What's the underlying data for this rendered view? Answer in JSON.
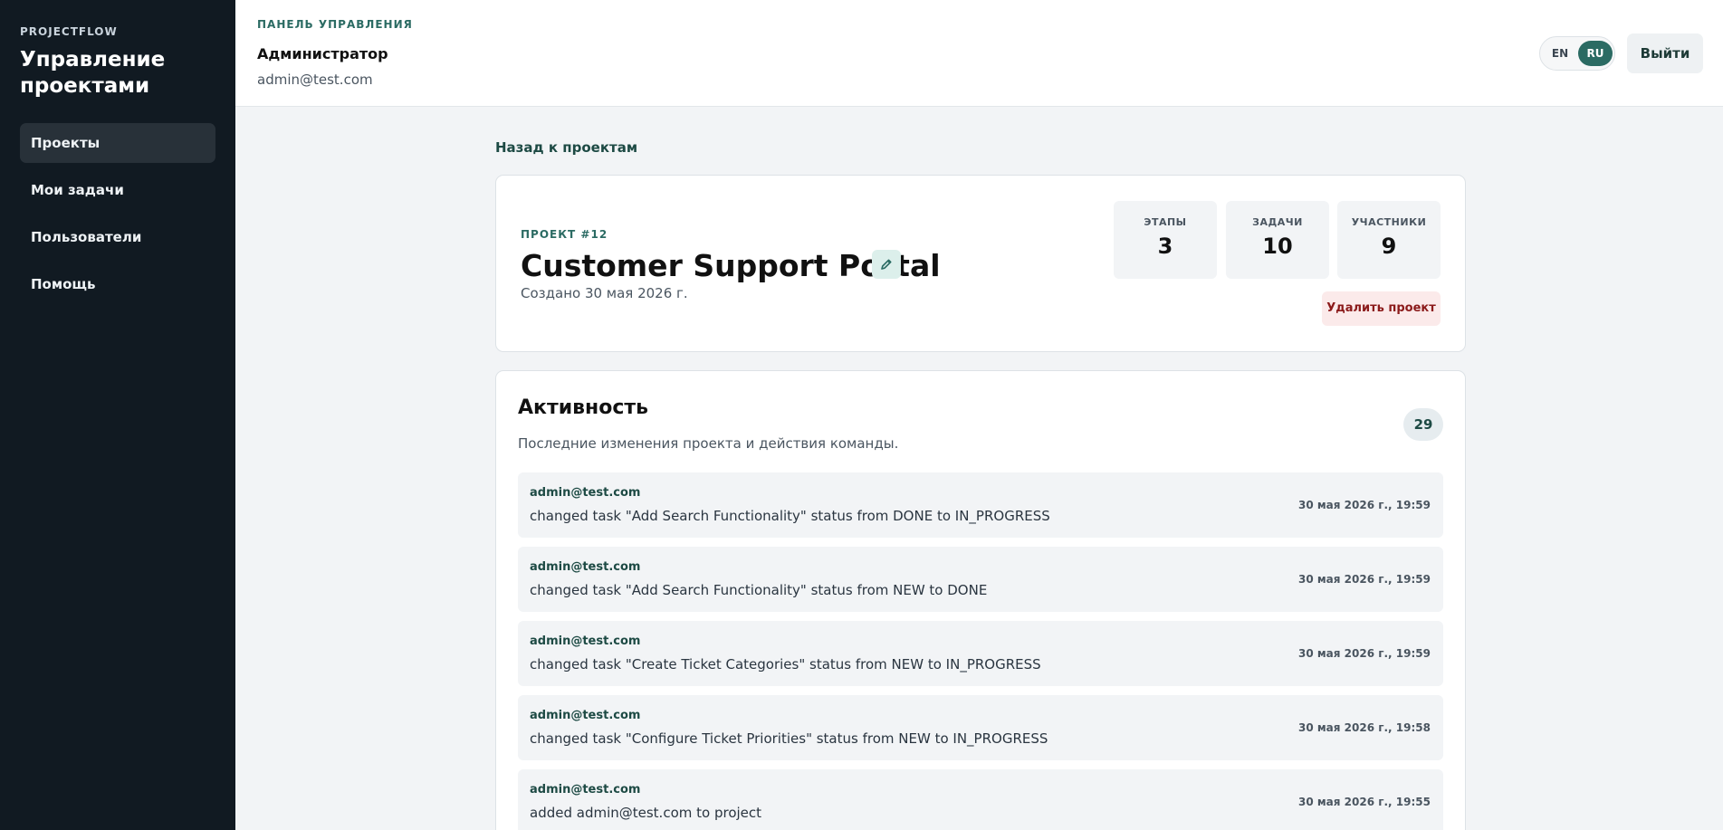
{
  "sidebar": {
    "brand_kicker": "PROJECTFLOW",
    "brand_title": "Управление проектами",
    "items": [
      {
        "label": "Проекты"
      },
      {
        "label": "Мои задачи"
      },
      {
        "label": "Пользователи"
      },
      {
        "label": "Помощь"
      }
    ]
  },
  "header": {
    "kicker": "ПАНЕЛЬ УПРАВЛЕНИЯ",
    "user_name": "Администратор",
    "user_email": "admin@test.com",
    "lang_en": "EN",
    "lang_ru": "RU",
    "logout_label": "Выйти"
  },
  "main": {
    "back_label": "Назад к проектам",
    "project": {
      "kicker": "ПРОЕКТ #12",
      "title": "Customer Support Portal",
      "created": "Создано 30 мая 2026 г.",
      "stats": [
        {
          "label": "ЭТАПЫ",
          "value": "3"
        },
        {
          "label": "ЗАДАЧИ",
          "value": "10"
        },
        {
          "label": "УЧАСТНИКИ",
          "value": "9"
        }
      ],
      "delete_label": "Удалить проект"
    },
    "activity": {
      "title": "Активность",
      "subtitle": "Последние изменения проекта и действия команды.",
      "count": "29",
      "items": [
        {
          "user": "admin@test.com",
          "text": "changed task \"Add Search Functionality\" status from DONE to IN_PROGRESS",
          "time": "30 мая 2026 г., 19:59"
        },
        {
          "user": "admin@test.com",
          "text": "changed task \"Add Search Functionality\" status from NEW to DONE",
          "time": "30 мая 2026 г., 19:59"
        },
        {
          "user": "admin@test.com",
          "text": "changed task \"Create Ticket Categories\" status from NEW to IN_PROGRESS",
          "time": "30 мая 2026 г., 19:59"
        },
        {
          "user": "admin@test.com",
          "text": "changed task \"Configure Ticket Priorities\" status from NEW to IN_PROGRESS",
          "time": "30 мая 2026 г., 19:58"
        },
        {
          "user": "admin@test.com",
          "text": "added admin@test.com to project",
          "time": "30 мая 2026 г., 19:55"
        }
      ]
    }
  }
}
